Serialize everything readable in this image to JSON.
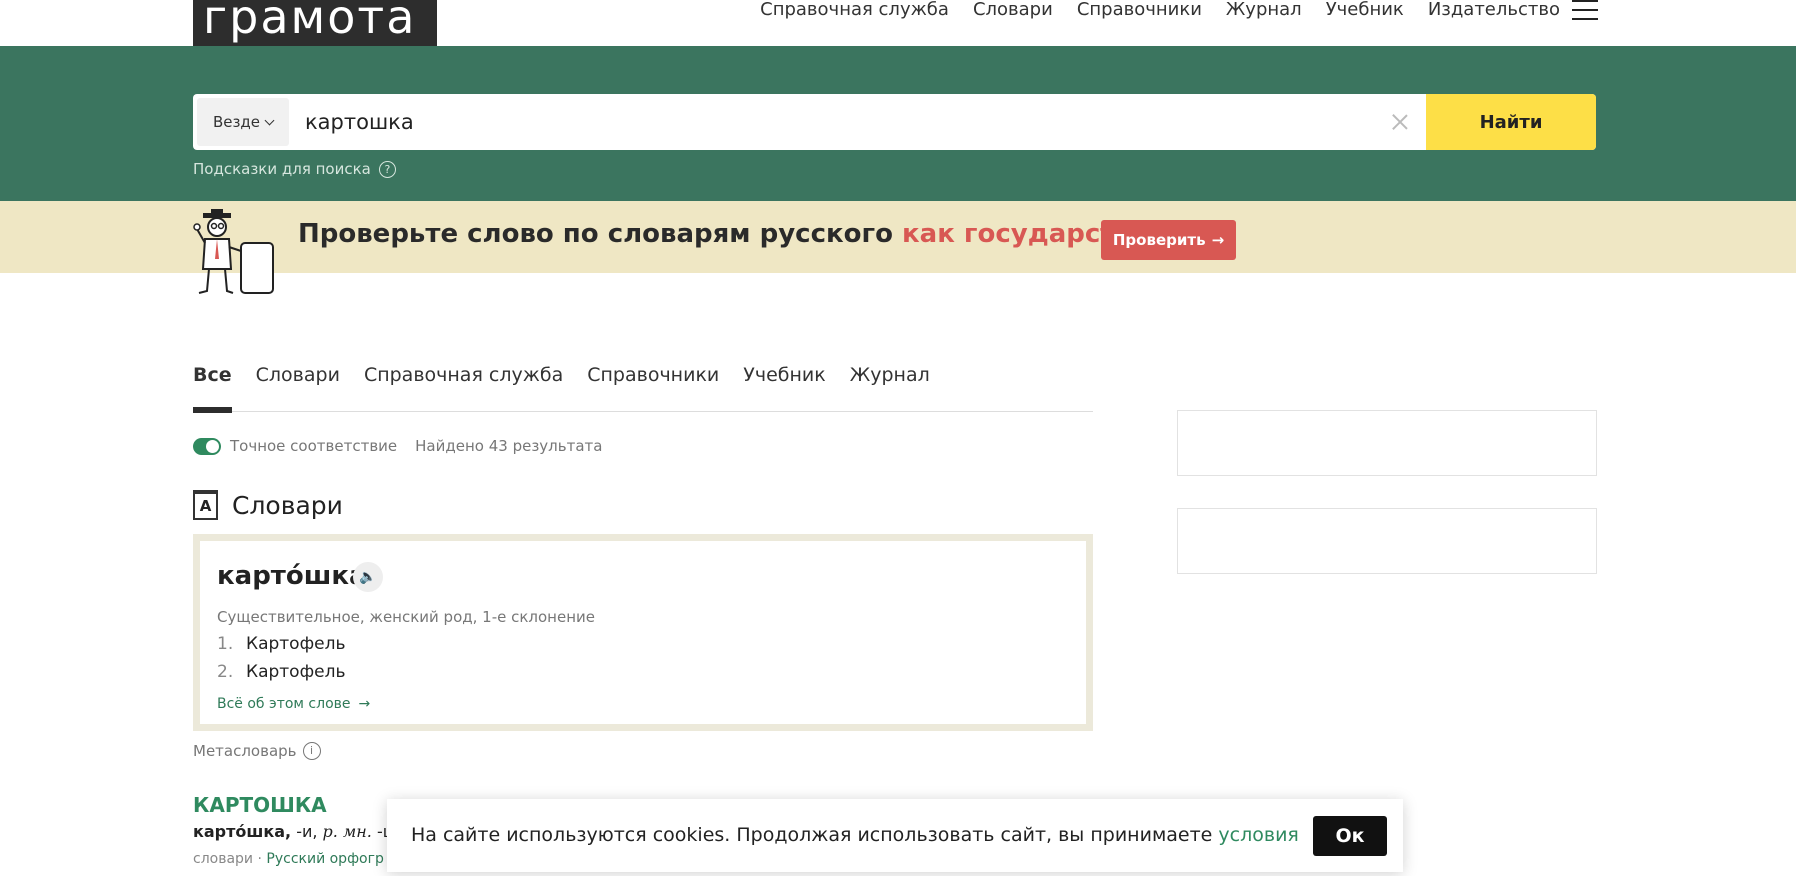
{
  "header": {
    "logo": "грамота",
    "nav": [
      "Справочная служба",
      "Словари",
      "Справочники",
      "Журнал",
      "Учебник",
      "Издательство"
    ]
  },
  "search": {
    "scope": "Везде",
    "query": "картошка",
    "button": "Найти",
    "hints": "Подсказки для поиска"
  },
  "promo": {
    "text": "Проверьте слово по словарям русского",
    "highlight": "как государственного",
    "button": "Проверить"
  },
  "tabs": [
    "Все",
    "Словари",
    "Справочная служба",
    "Справочники",
    "Учебник",
    "Журнал"
  ],
  "filters": {
    "exact": "Точное соответствие",
    "found": "Найдено 43 результата"
  },
  "section": {
    "title": "Словари",
    "icon_letter": "A"
  },
  "card": {
    "word": "карто́шка",
    "grammar": "Существительное, женский род, 1-е склонение",
    "definitions": [
      {
        "n": "1.",
        "text": "Картофель"
      },
      {
        "n": "2.",
        "text": "Картофель"
      }
    ],
    "more": "Всё об этом слове"
  },
  "meta": {
    "label": "Метасловарь"
  },
  "entry": {
    "title": "КАРТОШКА",
    "text_bold": "карто́шка,",
    "text_rest": " -и, ",
    "text_italic": "р. мн.",
    "text_tail": " -ше",
    "src_plain": "словари",
    "src_sep": "·",
    "src_link": "Русский орфогр"
  },
  "cookie": {
    "text": "На сайте используются cookies. Продолжая использовать сайт, вы принимаете ",
    "link": "условия",
    "button": "Ок"
  },
  "colors": {
    "search_band": "#3b755f",
    "find_button": "#fddf47",
    "promo_bg": "#efe7c4",
    "accent_red": "#d85853",
    "accent_green": "#2f8a5f"
  }
}
